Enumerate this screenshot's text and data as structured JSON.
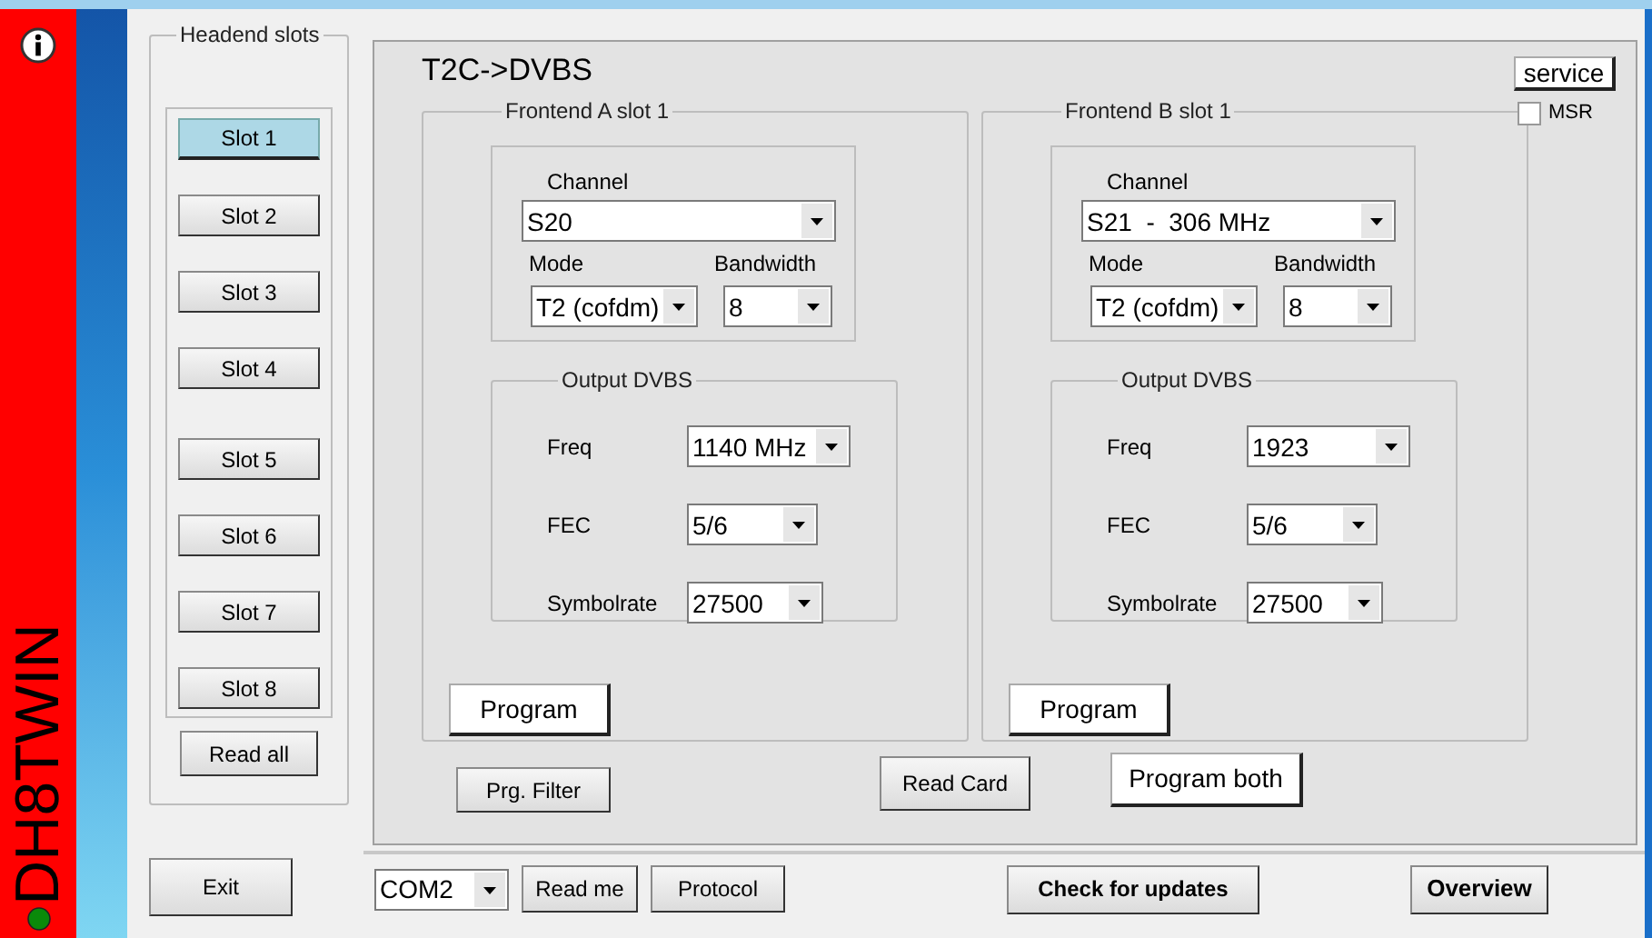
{
  "sidebar": {
    "brand": "DH8TWIN"
  },
  "headend": {
    "title": "Headend slots",
    "slots": [
      {
        "label": "Slot 1",
        "selected": true
      },
      {
        "label": "Slot 2",
        "selected": false
      },
      {
        "label": "Slot 3",
        "selected": false
      },
      {
        "label": "Slot 4",
        "selected": false
      },
      {
        "label": "Slot 5",
        "selected": false
      },
      {
        "label": "Slot 6",
        "selected": false
      },
      {
        "label": "Slot 7",
        "selected": false
      },
      {
        "label": "Slot 8",
        "selected": false
      }
    ],
    "read_all": "Read all"
  },
  "exit": "Exit",
  "panel": {
    "title": "T2C->DVBS",
    "service": "service",
    "msr": {
      "label": "MSR",
      "checked": false
    },
    "frontends": [
      {
        "title": "Frontend A slot 1",
        "channel_label": "Channel",
        "channel": "S20",
        "mode_label": "Mode",
        "mode": "T2 (cofdm)",
        "bandwidth_label": "Bandwidth",
        "bandwidth": "8",
        "output_title": "Output DVBS",
        "fields": [
          {
            "label": "Freq",
            "value": "1140 MHz"
          },
          {
            "label": "FEC",
            "value": "5/6"
          },
          {
            "label": "Symbolrate",
            "value": "27500"
          }
        ],
        "program": "Program"
      },
      {
        "title": "Frontend B slot 1",
        "channel_label": "Channel",
        "channel": "S21  -  306 MHz",
        "mode_label": "Mode",
        "mode": "T2 (cofdm)",
        "bandwidth_label": "Bandwidth",
        "bandwidth": "8",
        "output_title": "Output DVBS",
        "fields": [
          {
            "label": "Freq",
            "value": "1923"
          },
          {
            "label": "FEC",
            "value": "5/6"
          },
          {
            "label": "Symbolrate",
            "value": "27500"
          }
        ],
        "program": "Program"
      }
    ],
    "prg_filter": "Prg. Filter",
    "read_card": "Read Card",
    "program_both": "Program both"
  },
  "bottom_bar": {
    "port": "COM2",
    "buttons": [
      "Read me",
      "Protocol"
    ],
    "check_updates": "Check for updates",
    "overview": "Overview"
  }
}
